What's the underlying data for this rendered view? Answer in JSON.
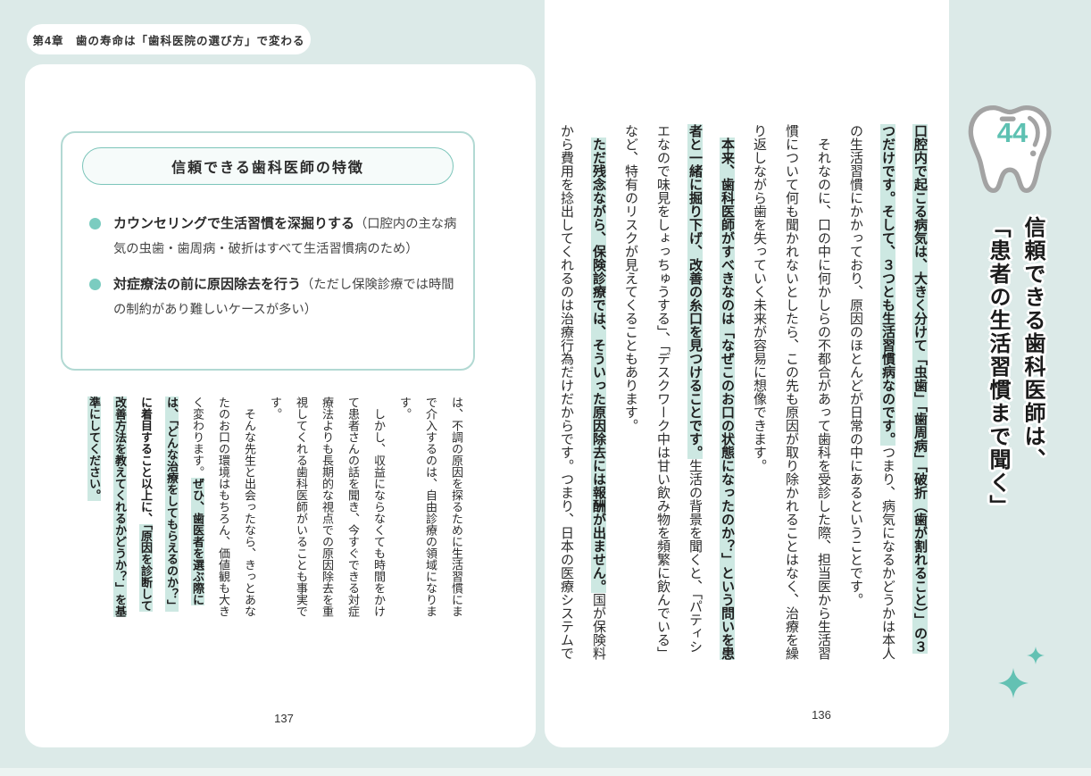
{
  "header": {
    "chapter": "第4章　歯の寿命は「歯科医院の選び方」で変わる"
  },
  "accent_colors": {
    "background": "#dceae8",
    "highlight": "#cde8e2",
    "teal_accent": "#5ec1b2",
    "box_border": "#b2d9d3"
  },
  "left_page": {
    "page_number": "137",
    "feature_box": {
      "title": "信頼できる歯科医師の特徴",
      "items": [
        {
          "bold": "カウンセリングで生活習慣を深掘りする",
          "note": "（口腔内の主な病気の虫歯・歯周病・破折はすべて生活習慣病のため）"
        },
        {
          "bold": "対症療法の前に原因除去を行う",
          "note": "（ただし保険診療では時間の制約があり難しいケースが多い）"
        }
      ]
    },
    "body": [
      {
        "indent": false,
        "runs": [
          {
            "t": "は、不調の原因を探るために生活習慣にまで介入するのは、自由診療の領域になります。",
            "s": "n"
          }
        ]
      },
      {
        "indent": true,
        "runs": [
          {
            "t": "しかし、収益にならなくても時間をかけて患者さんの話を聞き、今すぐできる対症療法よりも長期的な視点での原因除去を重視してくれる歯科医師がいることも事実です。",
            "s": "n"
          }
        ]
      },
      {
        "indent": true,
        "runs": [
          {
            "t": "そんな先生と出会ったなら、きっとあなたのお口の環境はもちろん、価値観も大きく変わります。",
            "s": "n"
          },
          {
            "t": "ぜひ、歯医者を選ぶ際には、「どんな治療をしてもらえるのか？」",
            "s": "hl"
          },
          {
            "t": "に着目すること以上に、",
            "s": "b"
          },
          {
            "t": "「原因を診断して改善方法を教えてくれるかどうか？」を基準にしてください。",
            "s": "hl"
          }
        ]
      }
    ]
  },
  "right_page": {
    "page_number": "136",
    "section_number": "44",
    "title_lines": [
      "信頼できる歯科医師は、",
      "「患者の生活習慣まで聞く」"
    ],
    "body": [
      {
        "indent": false,
        "runs": [
          {
            "t": "口腔内で起こる病気は、大きく分けて「虫歯」「歯周病」「破折（歯が割れること）」の３つだけです。そして、３つとも生活習慣病なのです。",
            "s": "hl"
          },
          {
            "t": "つまり、病気になるかどうかは本人の生活習慣にかかっており、原因のほとんどが日常の中にあるということです。",
            "s": "n"
          }
        ]
      },
      {
        "indent": true,
        "runs": [
          {
            "t": "それなのに、口の中に何かしらの不都合があって歯科を受診した際、担当医から生活習慣について何も聞かれないとしたら、この先も原因が取り除かれることはなく、治療を繰り返しながら歯を失っていく未来が容易に想像できます。",
            "s": "n"
          }
        ]
      },
      {
        "indent": true,
        "runs": [
          {
            "t": "本来、歯科医師がすべきなのは「なぜこのお口の状態になったのか？」という問いを患者と一緒に掘り下げ、改善の糸口を見つけることです。",
            "s": "hl"
          },
          {
            "t": "生活の背景を聞くと、「パティシエなので味見をしょっちゅうする」、「デスクワーク中は甘い飲み物を頻繁に飲んでいる」など、特有のリスクが見えてくることもあります。",
            "s": "n"
          }
        ]
      },
      {
        "indent": true,
        "runs": [
          {
            "t": "ただ残念ながら、保険診療では、そういった原因除去には報酬が出ません。",
            "s": "hl"
          },
          {
            "t": "国が保険料から費用を捻出してくれるのは治療行為だけだからです。つまり、日本の医療システムで",
            "s": "n"
          }
        ]
      }
    ]
  }
}
